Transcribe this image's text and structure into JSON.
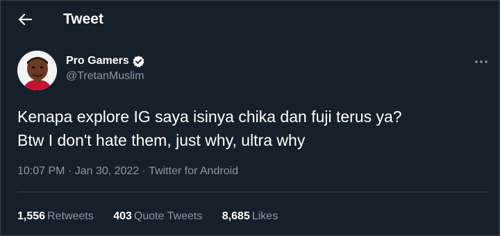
{
  "header": {
    "title": "Tweet",
    "back_icon": "arrow-left-icon"
  },
  "author": {
    "display_name": "Pro Gamers",
    "handle": "@TretanMuslim",
    "verified_icon": "verified-badge-icon",
    "more_icon": "more-horizontal-icon"
  },
  "tweet": {
    "lines": [
      "Kenapa explore IG saya isinya chika dan fuji terus ya?",
      "Btw I don't hate them, just why, ultra why"
    ]
  },
  "meta": {
    "time": "10:07 PM",
    "separator": " · ",
    "date": "Jan 30, 2022",
    "source": "Twitter for Android"
  },
  "stats": {
    "retweets_count": "1,556",
    "retweets_label": "Retweets",
    "quotes_count": "403",
    "quotes_label": "Quote Tweets",
    "likes_count": "8,685",
    "likes_label": "Likes"
  },
  "colors": {
    "background": "#15202b",
    "text_primary": "#ffffff",
    "text_secondary": "#8b98a5",
    "divider": "#38444d",
    "verified": "#1d9bf0"
  }
}
